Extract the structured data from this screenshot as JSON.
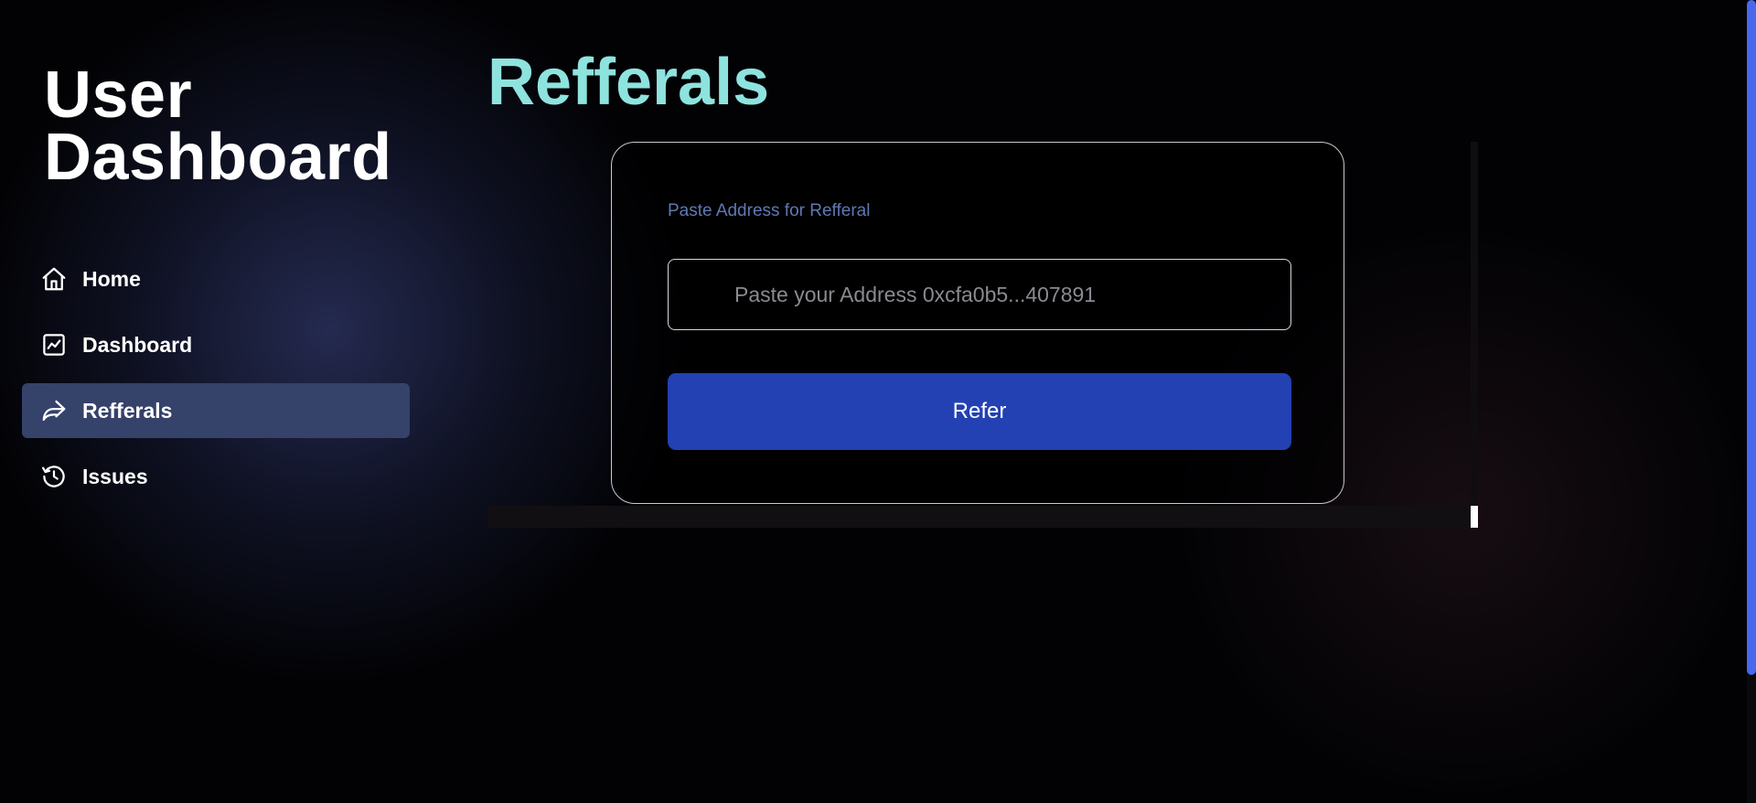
{
  "sidebar": {
    "title": "User Dashboard",
    "items": [
      {
        "label": "Home",
        "icon": "home-icon",
        "active": false
      },
      {
        "label": "Dashboard",
        "icon": "chart-icon",
        "active": false
      },
      {
        "label": "Refferals",
        "icon": "share-icon",
        "active": true
      },
      {
        "label": "Issues",
        "icon": "history-icon",
        "active": false
      }
    ]
  },
  "main": {
    "title": "Refferals",
    "card": {
      "field_label": "Paste Address for Refferal",
      "input_placeholder": "Paste your Address 0xcfa0b5...407891",
      "input_value": "",
      "button_label": "Refer"
    }
  },
  "colors": {
    "accent_title": "#8ee3de",
    "button": "#2341b3",
    "active_nav": "#35426a",
    "label": "#5f78b3",
    "scroll_thumb": "#4a68ee"
  }
}
